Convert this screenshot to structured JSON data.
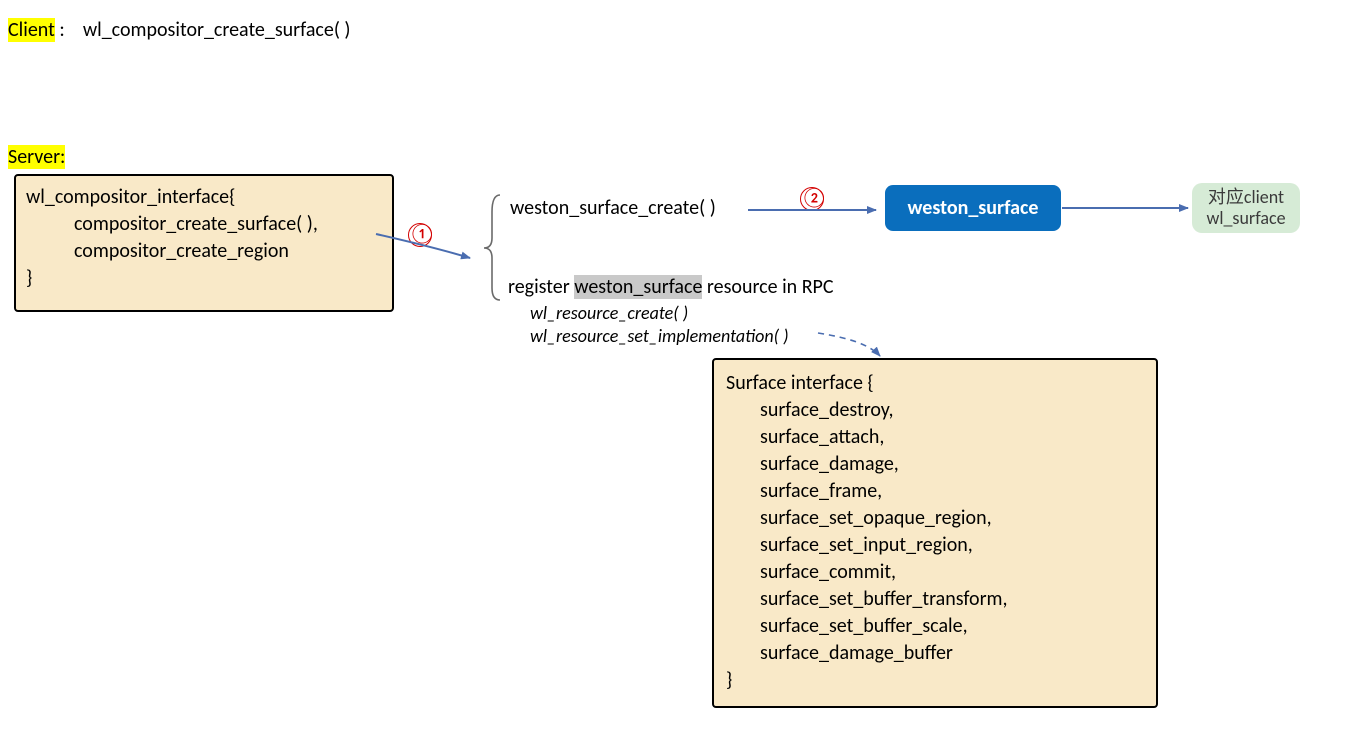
{
  "client": {
    "label": "Client",
    "call": "wl_compositor_create_surface( )"
  },
  "server": {
    "label": "Server:"
  },
  "compositor_interface": {
    "title": "wl_compositor_interface{",
    "line1": "compositor_create_surface( ),",
    "line2": "compositor_create_region",
    "close": "}"
  },
  "step1_marker": "①",
  "weston_call": "weston_surface_create( )",
  "step2_marker": "②",
  "weston_surface_box": "weston_surface",
  "client_wl_surface": {
    "line1": "对应client",
    "line2": "wl_surface"
  },
  "register_text": {
    "prefix": "register ",
    "highlight": "weston_surface",
    "suffix": " resource in RPC"
  },
  "rpc_calls": {
    "line1": "wl_resource_create( )",
    "line2": "wl_resource_set_implementation( )"
  },
  "surface_interface": {
    "title": "Surface interface {",
    "items": [
      "surface_destroy,",
      "surface_attach,",
      "surface_damage,",
      "surface_frame,",
      "surface_set_opaque_region,",
      "surface_set_input_region,",
      "surface_commit,",
      "surface_set_buffer_transform,",
      "surface_set_buffer_scale,",
      "surface_damage_buffer"
    ],
    "close": "}"
  },
  "colors": {
    "highlight": "#ffff00",
    "parchment": "#f9e9c8",
    "blue": "#0a6ebd",
    "green": "#d6ebd6",
    "red": "#d30000",
    "arrow": "#4a6db0",
    "grey": "#c9c9c9"
  }
}
